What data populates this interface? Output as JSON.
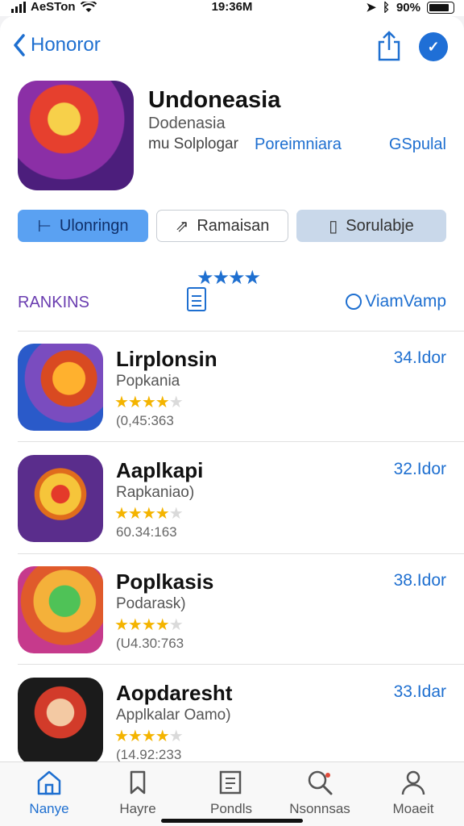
{
  "status_bar": {
    "carrier": "AeSTon",
    "time": "19:36M",
    "battery": "90%"
  },
  "nav": {
    "back_label": "Honoror"
  },
  "hero": {
    "title": "Undoneasia",
    "subtitle": "Dodenasia",
    "meta": "mu Solplogar",
    "link_primary": "Poreimniara",
    "link_secondary": "GSpulal"
  },
  "pills": [
    {
      "label": "Ulonringn"
    },
    {
      "label": "Ramaisan"
    },
    {
      "label": "Sorulabje"
    }
  ],
  "rankings": {
    "label": "RANKINS",
    "right_label": "ViamVamp",
    "stars": "★★★★"
  },
  "apps": [
    {
      "title": "Lirplonsin",
      "subtitle": "Popkania",
      "rating": 4,
      "rating_count": "(0,45:363",
      "price": "34.Idor"
    },
    {
      "title": "Aaplkapi",
      "subtitle": "Rapkaniao)",
      "rating": 4,
      "rating_count": "60.34:163",
      "price": "32.Idor"
    },
    {
      "title": "Poplkasis",
      "subtitle": "Podarask)",
      "rating": 4,
      "rating_count": "(U4.30:763",
      "price": "38.Idor"
    },
    {
      "title": "Aopdaresht",
      "subtitle": "Applkalar Oamo)",
      "rating": 4,
      "rating_count": "(14.92:233",
      "price": "33.Idar"
    }
  ],
  "tabs": [
    {
      "label": "Nanye",
      "icon": "home-icon",
      "active": true
    },
    {
      "label": "Hayre",
      "icon": "bookmark-icon",
      "active": false
    },
    {
      "label": "Pondls",
      "icon": "edit-icon",
      "active": false
    },
    {
      "label": "Nsonnsas",
      "icon": "search-icon",
      "active": false
    },
    {
      "label": "Moaeit",
      "icon": "person-icon",
      "active": false
    }
  ],
  "colors": {
    "accent": "#1e6fd0",
    "star": "#f4b400",
    "rank_label": "#6a3db0"
  }
}
